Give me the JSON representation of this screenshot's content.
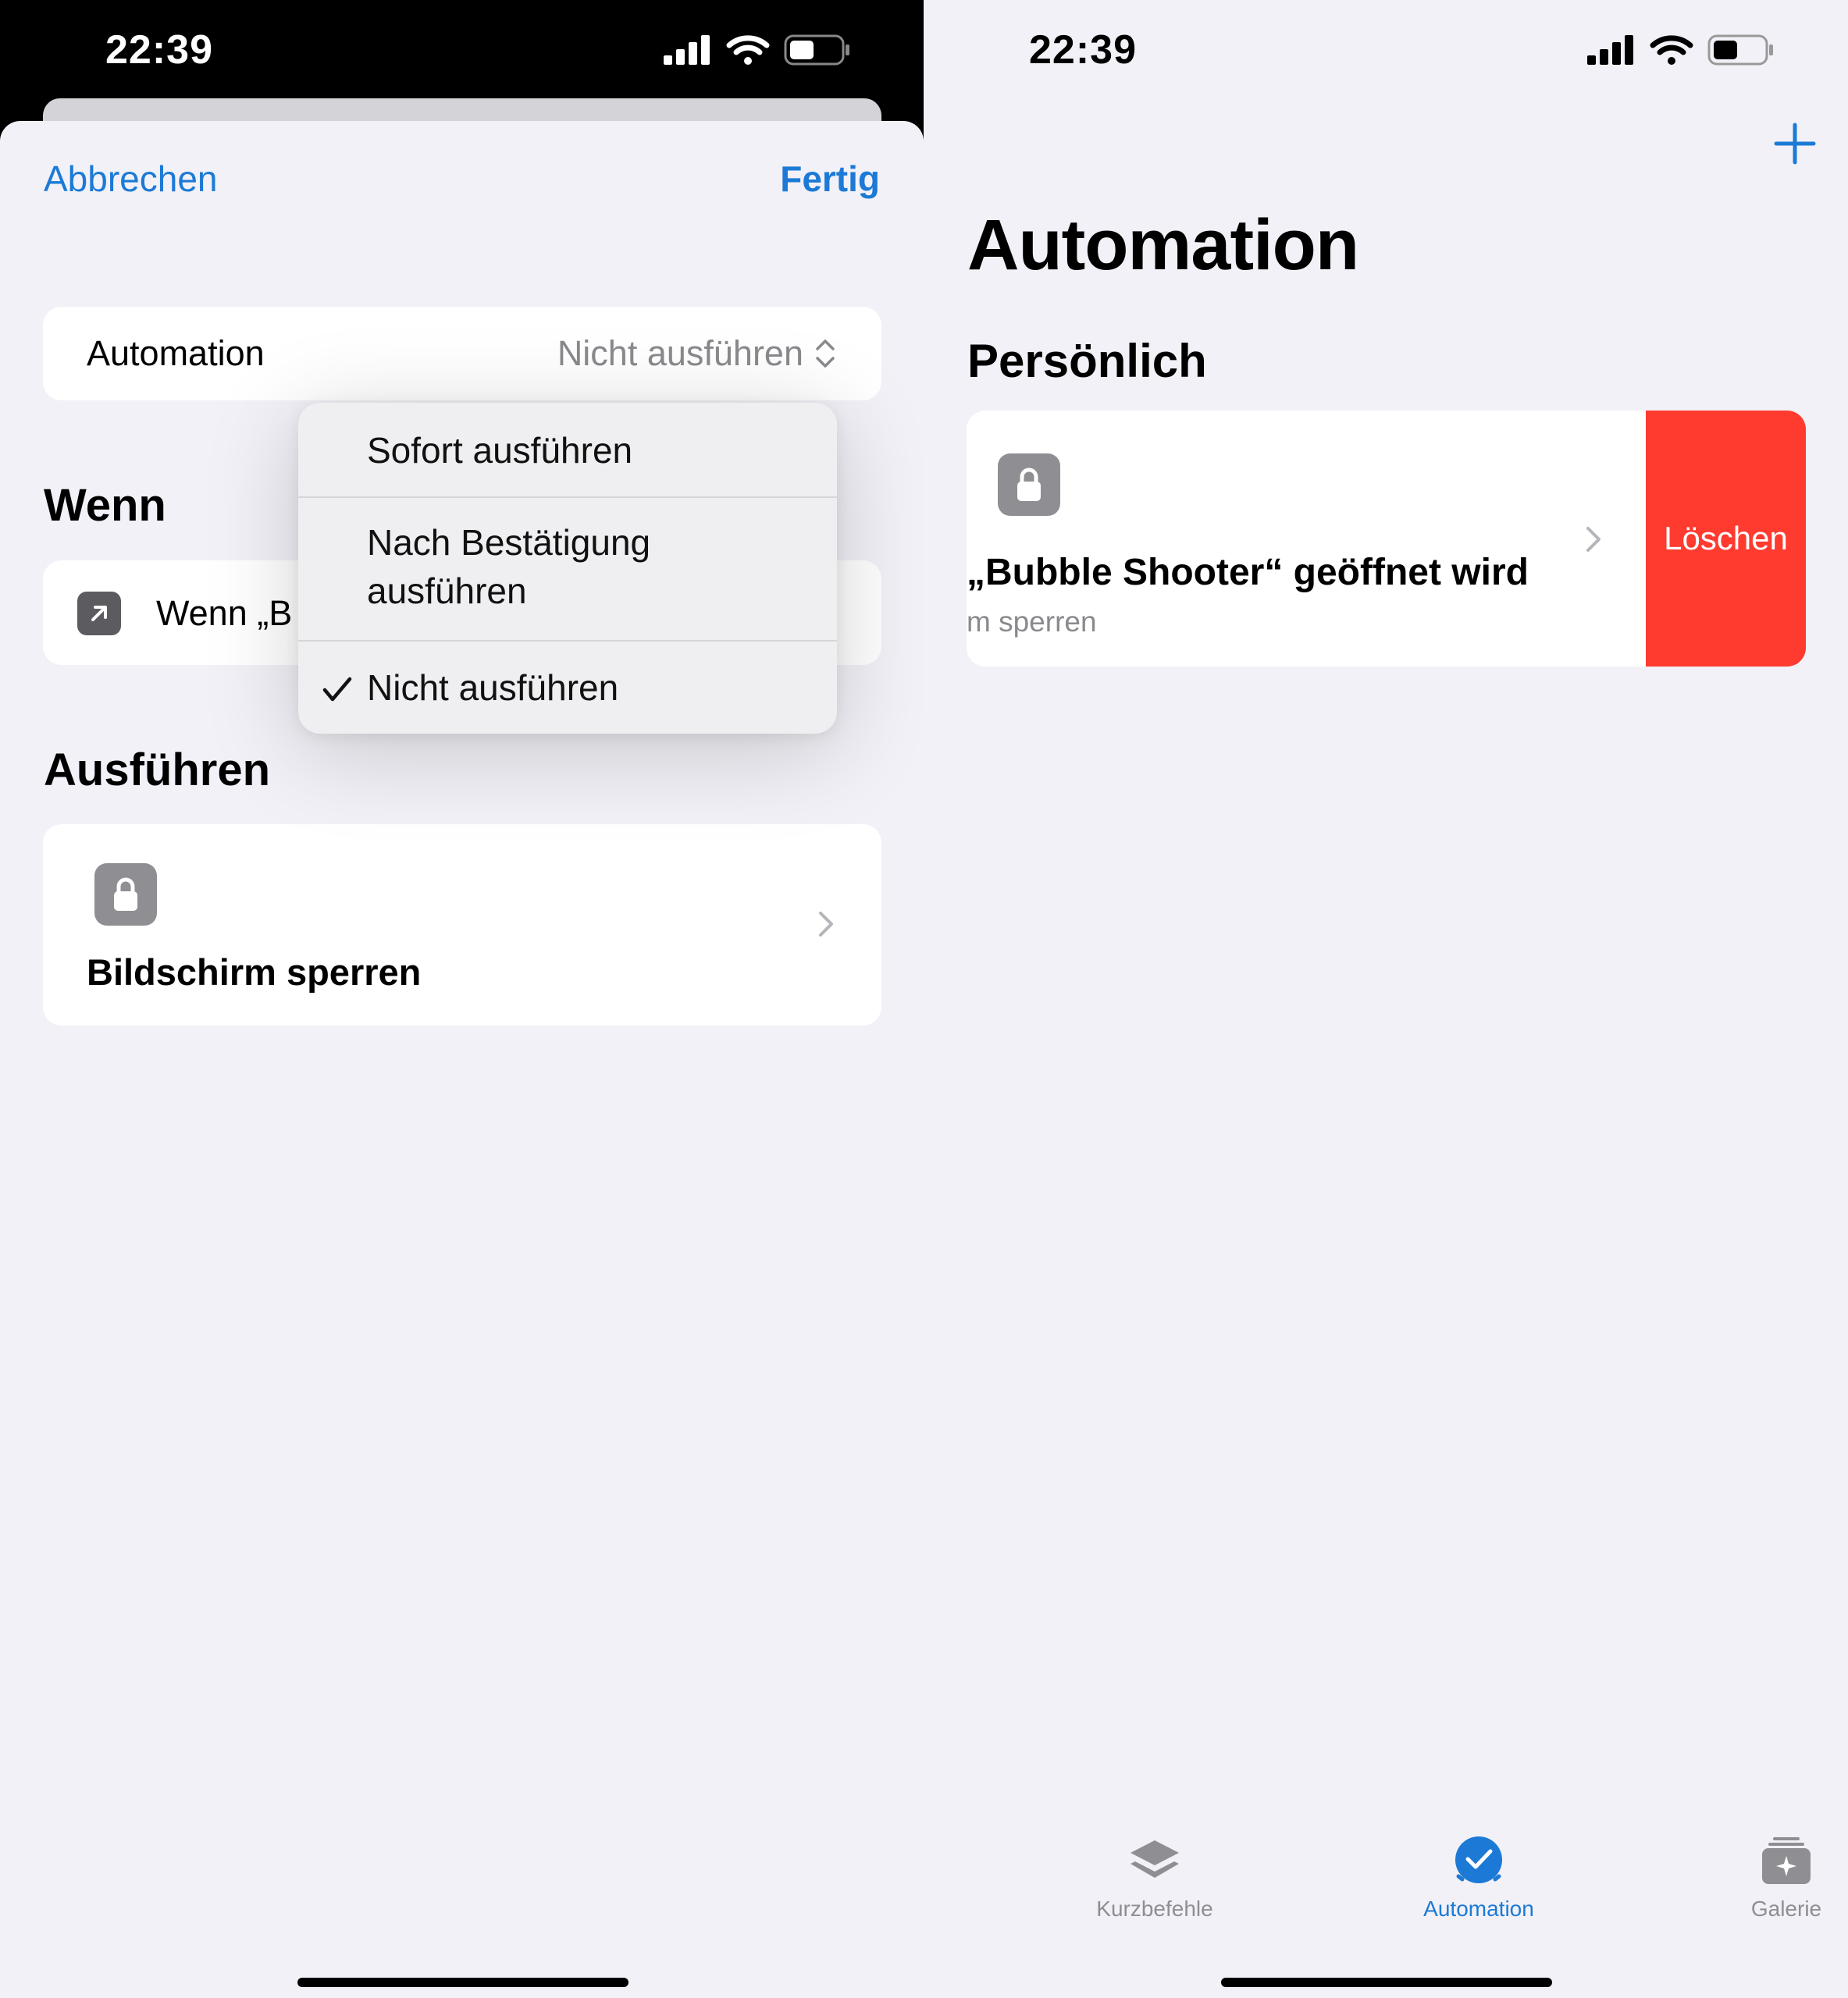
{
  "left": {
    "status": {
      "time": "22:39"
    },
    "nav": {
      "cancel": "Abbrechen",
      "done": "Fertig"
    },
    "automation_row": {
      "label": "Automation",
      "value": "Nicht ausführen"
    },
    "sections": {
      "wenn": "Wenn",
      "ausfuehren": "Ausführen"
    },
    "trigger": {
      "text": "Wenn „B"
    },
    "action": {
      "label": "Bildschirm sperren"
    },
    "menu": {
      "options": [
        {
          "label": "Sofort ausführen",
          "selected": false
        },
        {
          "label": "Nach Bestätigung ausführen",
          "selected": false
        },
        {
          "label": "Nicht ausführen",
          "selected": true
        }
      ]
    }
  },
  "right": {
    "status": {
      "time": "22:39"
    },
    "title": "Automation",
    "section": "Persönlich",
    "automation_card": {
      "title": "„Bubble Shooter“ geöffnet wird",
      "subtitle": "m sperren",
      "delete_label": "Löschen"
    },
    "tabs": [
      {
        "label": "Kurzbefehle",
        "icon": "layers-icon",
        "active": false
      },
      {
        "label": "Automation",
        "icon": "checkmark-circle-icon",
        "active": true
      },
      {
        "label": "Galerie",
        "icon": "gallery-icon",
        "active": false
      }
    ]
  },
  "colors": {
    "accent": "#1c7ad6",
    "destructive": "#ff3b30",
    "background": "#f2f1f7",
    "secondary_text": "#8a8a8e"
  }
}
